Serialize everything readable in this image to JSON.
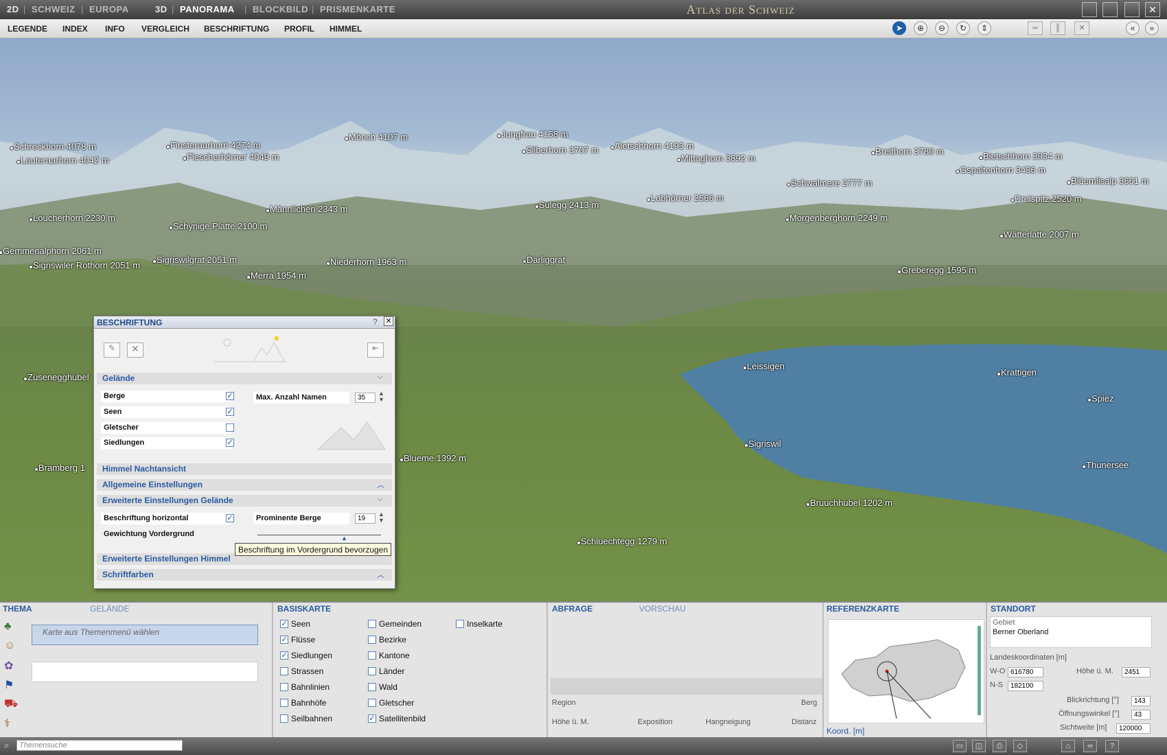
{
  "topbar": {
    "views": [
      "2D",
      "SCHWEIZ",
      "EUROPA",
      "3D",
      "PANORAMA",
      "BLOCKBILD",
      "PRISMENKARTE"
    ],
    "title": "Atlas der Schweiz"
  },
  "menu": [
    "LEGENDE",
    "INDEX",
    "INFO",
    "VERGLEICH",
    "BESCHRIFTUNG",
    "PROFIL",
    "HIMMEL"
  ],
  "tools": {
    "select": "➤",
    "zoom_in": "⊕",
    "zoom_out": "⊖",
    "rotate": "↻",
    "pan": "⇕",
    "back": "«",
    "forward": "»"
  },
  "labels": [
    {
      "name": "Schreckhorn",
      "h": "4078 m"
    },
    {
      "name": "Lauteraarhorn",
      "h": "4042 m"
    },
    {
      "name": "Finsteraarhorn",
      "h": "4274 m"
    },
    {
      "name": "Fiescherhörner",
      "h": "4049 m"
    },
    {
      "name": "Mönch",
      "h": "4107 m"
    },
    {
      "name": "Jungfrau",
      "h": "4158 m"
    },
    {
      "name": "Silberhorn",
      "h": "3707 m"
    },
    {
      "name": "Aletschhorn",
      "h": "4193 m"
    },
    {
      "name": "Mittaghorn",
      "h": "3892 m"
    },
    {
      "name": "Breithorn",
      "h": "3780 m"
    },
    {
      "name": "Bietschhorn",
      "h": "3934 m"
    },
    {
      "name": "Gspaltenhorn",
      "h": "3436 m"
    },
    {
      "name": "Blüemlisalp",
      "h": "3661 m"
    },
    {
      "name": "Schwalmere",
      "h": "2777 m"
    },
    {
      "name": "Sulegg",
      "h": "2413 m"
    },
    {
      "name": "Lobhörner",
      "h": "2566 m"
    },
    {
      "name": "Dreispitz",
      "h": "2520 m"
    },
    {
      "name": "Männlichen",
      "h": "2343 m"
    },
    {
      "name": "Loucherhorn",
      "h": "2230 m"
    },
    {
      "name": "Schynige Platte",
      "h": "2100 m"
    },
    {
      "name": "Morgenberghorn",
      "h": "2249 m"
    },
    {
      "name": "Wätterlatte",
      "h": "2007 m"
    },
    {
      "name": "Gemmenalphorn",
      "h": "2061 m"
    },
    {
      "name": "Sigriswiler Rothorn",
      "h": "2051 m"
    },
    {
      "name": "Sigriswilgrat",
      "h": "2051 m"
    },
    {
      "name": "Niederhorn",
      "h": "1963 m"
    },
    {
      "name": "Därliggrat",
      "h": ""
    },
    {
      "name": "Merra",
      "h": "1954 m"
    },
    {
      "name": "Greberegg",
      "h": "1595 m"
    },
    {
      "name": "Leissigen",
      "h": ""
    },
    {
      "name": "Krattigen",
      "h": ""
    },
    {
      "name": "Spiez",
      "h": ""
    },
    {
      "name": "Züsenegghubel",
      "h": ""
    },
    {
      "name": "Sigriswil",
      "h": ""
    },
    {
      "name": "Bramberg",
      "h": "1"
    },
    {
      "name": "Blueme",
      "h": "1392 m"
    },
    {
      "name": "Thunersee",
      "h": ""
    },
    {
      "name": "Bruuchhubel",
      "h": "1202 m"
    },
    {
      "name": "Schluechtegg",
      "h": "1279 m"
    }
  ],
  "dialog": {
    "title": "BESCHRIFTUNG",
    "help": "?",
    "close": "✕",
    "sections": {
      "gelaende": "Gelände",
      "himmel": "Himmel Nachtansicht",
      "allgemein": "Allgemeine Einstellungen",
      "erweitert_gelaende": "Erweiterte Einstellungen Gelände",
      "erweitert_himmel": "Erweiterte Einstellungen Himmel",
      "schriftfarben": "Schriftfarben"
    },
    "rows": [
      {
        "label": "Berge",
        "checked": true
      },
      {
        "label": "Seen",
        "checked": true
      },
      {
        "label": "Gletscher",
        "checked": false
      },
      {
        "label": "Siedlungen",
        "checked": true
      }
    ],
    "max_names_label": "Max. Anzahl Namen",
    "max_names_value": "35",
    "horizontal_label": "Beschriftung horizontal",
    "horizontal_checked": true,
    "prominent_label": "Prominente Berge",
    "prominent_value": "19",
    "weighting_label": "Gewichtung Vordergrund",
    "weighting_level": 0.7,
    "tooltip": "Beschriftung im Vordergrund bevorzugen"
  },
  "bottom": {
    "thema_tab": "THEMA",
    "gelaende_tab": "GELÄNDE",
    "thema_placeholder": "Karte aus Themenmenü wählen",
    "basiskarte_tab": "BASISKARTE",
    "basis_col1": [
      {
        "label": "Seen",
        "checked": true
      },
      {
        "label": "Flüsse",
        "checked": true
      },
      {
        "label": "Siedlungen",
        "checked": true
      },
      {
        "label": "Strassen",
        "checked": false
      },
      {
        "label": "Bahnlinien",
        "checked": false
      },
      {
        "label": "Bahnhöfe",
        "checked": false
      },
      {
        "label": "Seilbahnen",
        "checked": false
      }
    ],
    "basis_col2": [
      {
        "label": "Gemeinden",
        "checked": false
      },
      {
        "label": "Bezirke",
        "checked": false
      },
      {
        "label": "Kantone",
        "checked": false
      },
      {
        "label": "Länder",
        "checked": false
      },
      {
        "label": "Wald",
        "checked": false
      },
      {
        "label": "Gletscher",
        "checked": false
      },
      {
        "label": "Satellitenbild",
        "checked": true
      }
    ],
    "basis_col3": [
      {
        "label": "Inselkarte",
        "checked": false
      }
    ],
    "abfrage_tab": "ABFRAGE",
    "vorschau_tab": "VORSCHAU",
    "abfrage_region": "Region",
    "abfrage_berg": "Berg",
    "abfrage_hoehe": "Höhe ü. M.",
    "abfrage_exposition": "Exposition",
    "abfrage_hangneigung": "Hangneigung",
    "abfrage_distanz": "Distanz",
    "referenz_tab": "REFERENZKARTE",
    "koord": "Koord. [m]",
    "standort_tab": "STANDORT",
    "gebiet_label": "Gebiet",
    "gebiet_value": "Berner Oberland",
    "landeskoord": "Landeskoordinaten [m]",
    "wo_label": "W-O",
    "wo_value": "616780",
    "ns_label": "N-S",
    "ns_value": "182100",
    "hoehe_label": "Höhe ü. M.",
    "hoehe_value": "2451",
    "blick_label": "Blickrichtung [°]",
    "blick_value": "143",
    "oeffnung_label": "Öffnungswinkel [°]",
    "oeffnung_value": "43",
    "sicht_label": "Sichtweite [m]",
    "sicht_value": "120000"
  },
  "statusbar": {
    "search_placeholder": "Themensuche"
  }
}
